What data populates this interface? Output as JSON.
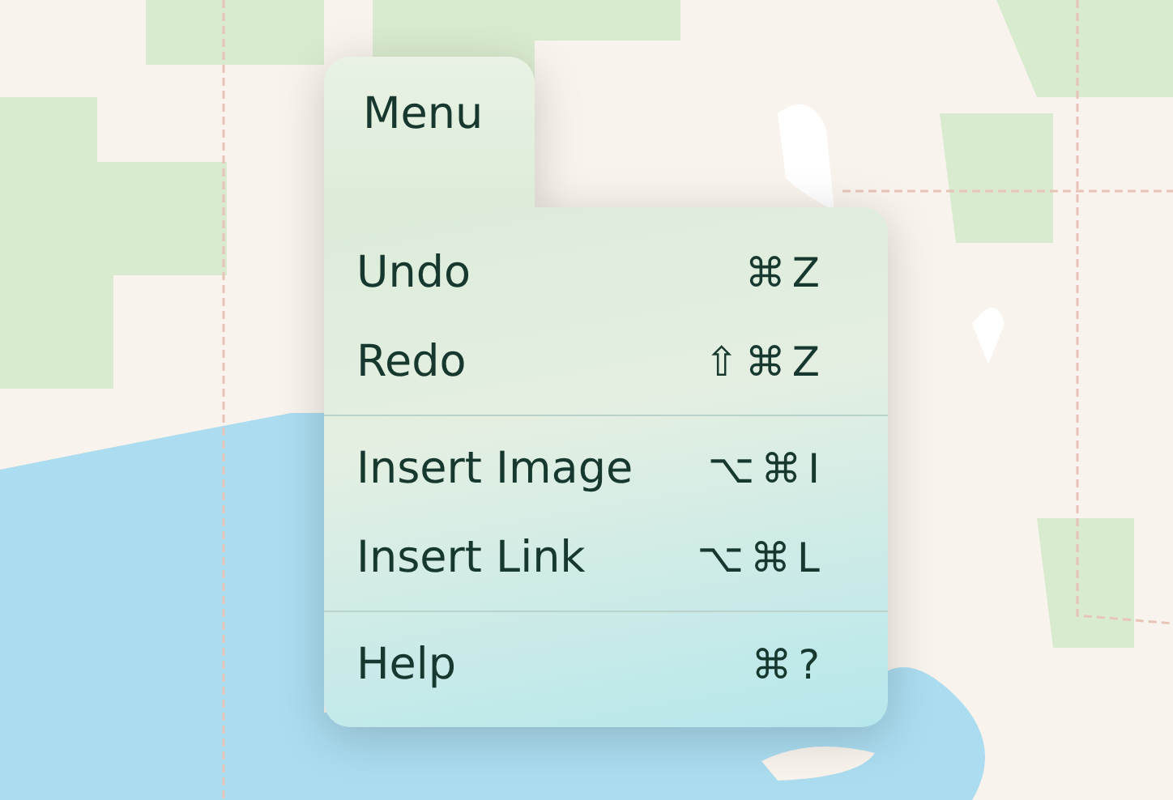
{
  "menu": {
    "title": "Menu",
    "sections": [
      {
        "items": [
          {
            "label": "Undo",
            "shortcut": "⌘Z"
          },
          {
            "label": "Redo",
            "shortcut": "⇧⌘Z"
          }
        ]
      },
      {
        "items": [
          {
            "label": "Insert Image",
            "shortcut": "⌥⌘I"
          },
          {
            "label": "Insert Link",
            "shortcut": "⌥⌘L"
          }
        ]
      },
      {
        "items": [
          {
            "label": "Help",
            "shortcut": "⌘?"
          }
        ]
      }
    ]
  }
}
